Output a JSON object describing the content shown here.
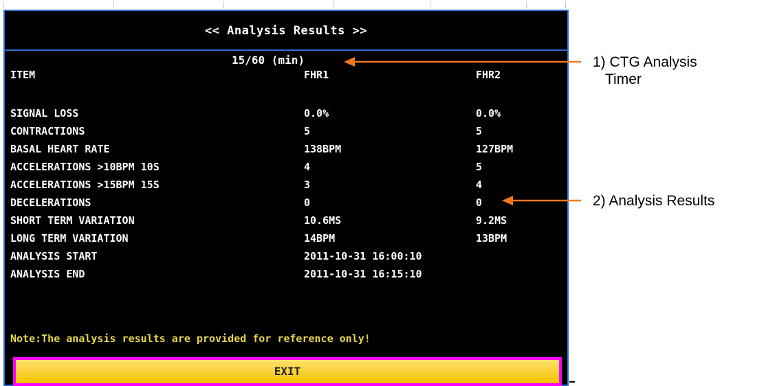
{
  "screen": {
    "title": "<< Analysis Results >>",
    "timer": "15/60 (min)",
    "header": {
      "item": "ITEM",
      "fhr1": "FHR1",
      "fhr2": "FHR2"
    },
    "rows": [
      {
        "item": "SIGNAL LOSS",
        "fhr1": "0.0%",
        "fhr2": "0.0%"
      },
      {
        "item": "CONTRACTIONS",
        "fhr1": "5",
        "fhr2": "5"
      },
      {
        "item": "BASAL HEART RATE",
        "fhr1": "138BPM",
        "fhr2": "127BPM"
      },
      {
        "item": "ACCELERATIONS >10BPM 10S",
        "fhr1": "4",
        "fhr2": "5"
      },
      {
        "item": "ACCELERATIONS >15BPM 15S",
        "fhr1": "3",
        "fhr2": "4"
      },
      {
        "item": "DECELERATIONS",
        "fhr1": "0",
        "fhr2": "0"
      },
      {
        "item": "SHORT TERM VARIATION",
        "fhr1": "10.6MS",
        "fhr2": "9.2MS"
      },
      {
        "item": "LONG TERM VARIATION",
        "fhr1": "14BPM",
        "fhr2": "13BPM"
      },
      {
        "item": "ANALYSIS START",
        "value": "2011-10-31 16:00:10"
      },
      {
        "item": "ANALYSIS END",
        "value": "2011-10-31 16:15:10"
      }
    ],
    "note": "Note:The analysis results are provided for reference only!",
    "exit_label": "EXIT"
  },
  "annotations": {
    "timer_label_line1": "1) CTG Analysis",
    "timer_label_line2": "Timer",
    "results_label": "2) Analysis Results"
  },
  "colors": {
    "screen_bg": "#000000",
    "border_blue": "#2a6fd8",
    "note_yellow": "#e8d84a",
    "exit_fill": "#f5c400",
    "exit_border": "#ff00ff",
    "arrow": "#f07820"
  }
}
